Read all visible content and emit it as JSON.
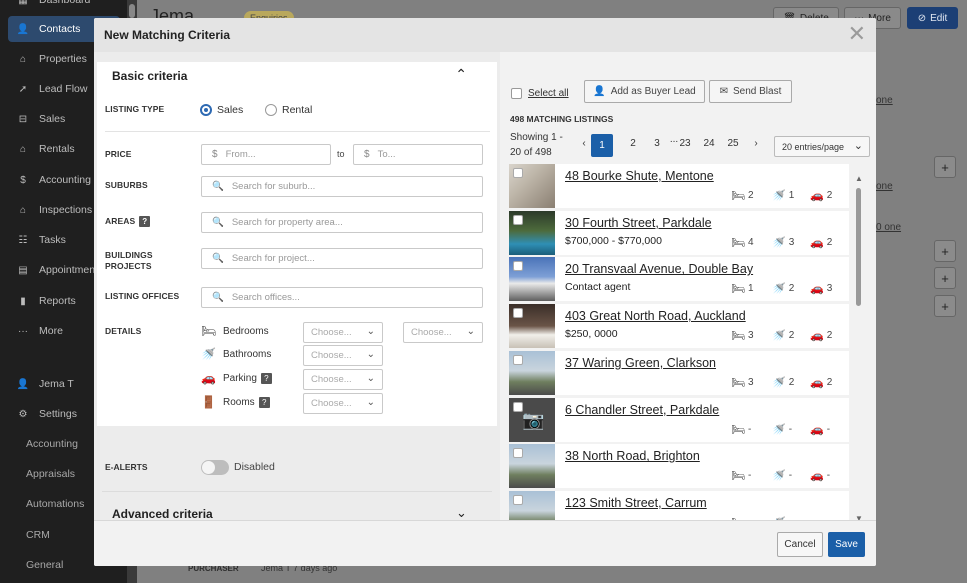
{
  "background": {
    "sidebar": {
      "items": [
        {
          "label": "Dashboard",
          "icon": "dashboard-icon",
          "glyph": "▦"
        },
        {
          "label": "Contacts",
          "icon": "person-icon",
          "glyph": "👤",
          "active": true
        },
        {
          "label": "Properties",
          "icon": "home-icon",
          "glyph": "⌂"
        },
        {
          "label": "Lead Flow",
          "icon": "lead-flow-icon",
          "glyph": "➚"
        },
        {
          "label": "Sales",
          "icon": "sales-icon",
          "glyph": "⊟"
        },
        {
          "label": "Rentals",
          "icon": "rentals-icon",
          "glyph": "⌂"
        },
        {
          "label": "Accounting",
          "icon": "dollar-icon",
          "glyph": "$"
        },
        {
          "label": "Inspections",
          "icon": "inspections-icon",
          "glyph": "⌂"
        },
        {
          "label": "Tasks",
          "icon": "tasks-icon",
          "glyph": "☷"
        },
        {
          "label": "Appointments",
          "icon": "calendar-icon",
          "glyph": "▤"
        },
        {
          "label": "Reports",
          "icon": "bar-chart-icon",
          "glyph": "▮"
        },
        {
          "label": "More",
          "icon": "more-icon",
          "glyph": "···"
        }
      ],
      "user": "Jema T",
      "settings": "Settings",
      "settings_sub": [
        "Accounting",
        "Appraisals",
        "Automations",
        "CRM",
        "General"
      ]
    },
    "title": "Jema",
    "badge": "Enquiries",
    "delete_label": "Delete",
    "more_label": "More",
    "edit_label": "Edit",
    "links": [
      "one",
      "one",
      "0 one"
    ],
    "footer_label": "PURCHASER",
    "footer_meta": "Jema T 7 days ago"
  },
  "modal": {
    "title": "New Matching Criteria",
    "close_glyph": "✕",
    "basic": {
      "title": "Basic criteria",
      "listing_type_label": "LISTING TYPE",
      "sales_label": "Sales",
      "rental_label": "Rental",
      "selected_type": "Sales",
      "price_label": "PRICE",
      "currency": "$",
      "price_from_placeholder": "From...",
      "price_to_label": "to",
      "price_to_placeholder": "To...",
      "suburbs_label": "SUBURBS",
      "suburbs_placeholder": "Search for suburb...",
      "areas_label": "AREAS",
      "areas_placeholder": "Search for property area...",
      "buildings_label": "BUILDINGS PROJECTS",
      "buildings_placeholder": "Search for project...",
      "offices_label": "LISTING OFFICES",
      "offices_placeholder": "Search offices...",
      "details_label": "DETAILS",
      "details": [
        {
          "label": "Bedrooms",
          "icon": "bed-icon",
          "glyph": "🛏"
        },
        {
          "label": "Bathrooms",
          "icon": "shower-icon",
          "glyph": "🚿"
        },
        {
          "label": "Parking",
          "icon": "car-icon",
          "glyph": "🚗"
        },
        {
          "label": "Rooms",
          "icon": "door-icon",
          "glyph": "🚪"
        }
      ],
      "choose_placeholder": "Choose...",
      "help_glyph": "?"
    },
    "ealerts": {
      "label": "E-ALERTS",
      "state": "Disabled",
      "enabled": false
    },
    "advanced": {
      "title": "Advanced criteria"
    },
    "right": {
      "select_all": "Select all",
      "add_buyer_lead": "Add as Buyer Lead",
      "send_blast": "Send Blast",
      "matching_count": "498 MATCHING LISTINGS",
      "showing": "Showing 1 - 20 of 498",
      "pages": [
        "1",
        "2",
        "3",
        "...",
        "23",
        "24",
        "25"
      ],
      "current_page": "1",
      "entries_per_page": "20 entries/page",
      "listings": [
        {
          "address": "48 Bourke Shute, Mentone",
          "price": "",
          "beds": "2",
          "baths": "1",
          "cars": "2",
          "photo": "interior"
        },
        {
          "address": "30 Fourth Street, Parkdale",
          "price": "$700,000 - $770,000",
          "beds": "4",
          "baths": "3",
          "cars": "2",
          "photo": "pool"
        },
        {
          "address": "20 Transvaal Avenue, Double Bay",
          "price": "Contact agent",
          "beds": "1",
          "baths": "2",
          "cars": "3",
          "photo": "house"
        },
        {
          "address": "403 Great North Road, Auckland",
          "price": "$250, 0000",
          "beds": "3",
          "baths": "2",
          "cars": "2",
          "photo": "bedroom"
        },
        {
          "address": "37 Waring Green, Clarkson",
          "price": "",
          "beds": "3",
          "baths": "2",
          "cars": "2",
          "photo": "street"
        },
        {
          "address": "6 Chandler Street, Parkdale",
          "price": "",
          "beds": "-",
          "baths": "-",
          "cars": "-",
          "photo": "camera"
        },
        {
          "address": "38 North Road, Brighton",
          "price": "",
          "beds": "-",
          "baths": "-",
          "cars": "-",
          "photo": "street"
        },
        {
          "address": "123 Smith Street, Carrum",
          "price": "",
          "beds": "-",
          "baths": "-",
          "cars": "-",
          "photo": "street"
        }
      ]
    },
    "footer": {
      "cancel": "Cancel",
      "save": "Save"
    },
    "colors": {
      "primary": "#1b5fa8",
      "sidebar": "#1f1f1f",
      "active_nav": "#2d4a6e"
    }
  }
}
